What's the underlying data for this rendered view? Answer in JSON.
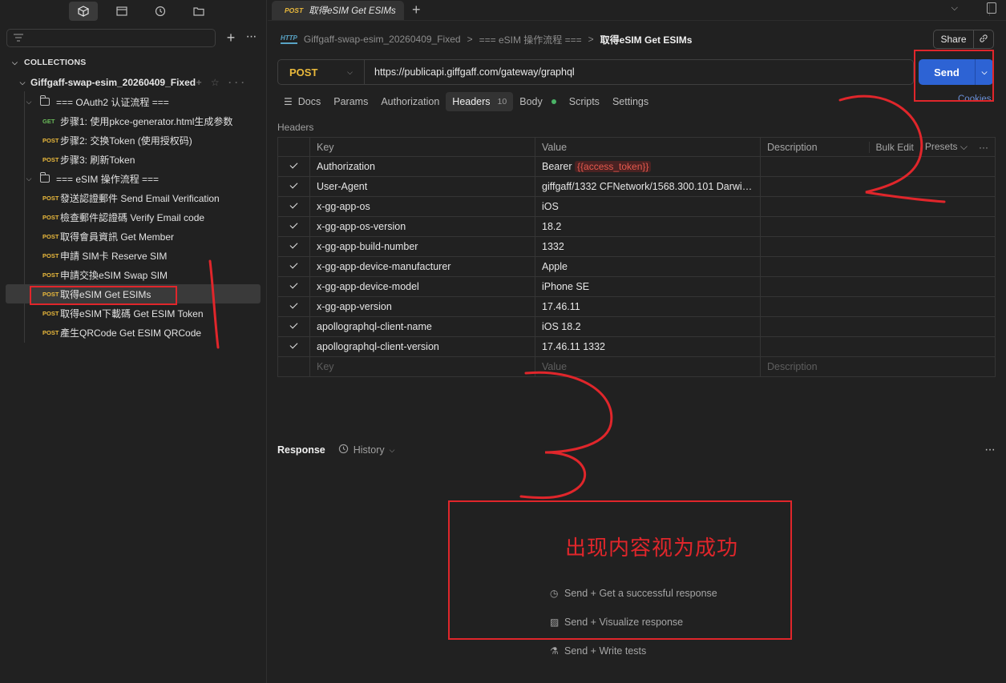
{
  "sidebar": {
    "collections_header": "COLLECTIONS",
    "collection_name": "Giffgaff-swap-esim_20260409_Fixed",
    "folders": [
      {
        "name": "=== OAuth2 认证流程 ===",
        "requests": [
          {
            "method": "GET",
            "name": "步骤1: 使用pkce-generator.html生成参数"
          },
          {
            "method": "POST",
            "name": "步骤2: 交换Token (使用授权码)"
          },
          {
            "method": "POST",
            "name": "步骤3: 刷新Token"
          }
        ]
      },
      {
        "name": "=== eSIM 操作流程 ===",
        "requests": [
          {
            "method": "POST",
            "name": "發送認證郵件 Send Email Verification"
          },
          {
            "method": "POST",
            "name": "檢查郵件認證碼 Verify Email code"
          },
          {
            "method": "POST",
            "name": "取得會員資訊 Get Member"
          },
          {
            "method": "POST",
            "name": "申請 SIM卡 Reserve SIM"
          },
          {
            "method": "POST",
            "name": "申請交換eSIM Swap SIM"
          },
          {
            "method": "POST",
            "name": "取得eSIM Get ESIMs"
          },
          {
            "method": "POST",
            "name": "取得eSIM下載碼 Get ESIM Token"
          },
          {
            "method": "POST",
            "name": "產生QRCode Get ESIM QRCode"
          }
        ]
      }
    ]
  },
  "tab": {
    "method": "POST",
    "title": "取得eSIM Get ESIMs"
  },
  "breadcrumb": {
    "collection": "Giffgaff-swap-esim_20260409_Fixed",
    "folder": "=== eSIM 操作流程 ===",
    "current": "取得eSIM Get ESIMs",
    "sep": ">",
    "icon_text": "HTTP"
  },
  "share_label": "Share",
  "request": {
    "method": "POST",
    "url": "https://publicapi.giffgaff.com/gateway/graphql",
    "send_label": "Send",
    "cookies_label": "Cookies"
  },
  "req_tabs": {
    "docs": "Docs",
    "params": "Params",
    "authorization": "Authorization",
    "headers": "Headers",
    "headers_count": "10",
    "body": "Body",
    "scripts": "Scripts",
    "settings": "Settings"
  },
  "headers_section": {
    "title": "Headers",
    "columns": {
      "key": "Key",
      "value": "Value",
      "description": "Description"
    },
    "bulk_edit": "Bulk Edit",
    "presets": "Presets",
    "rows": [
      {
        "key": "Authorization",
        "value_prefix": "Bearer ",
        "value_var": "{{access_token}}"
      },
      {
        "key": "User-Agent",
        "value": "giffgaff/1332 CFNetwork/1568.300.101 Darwin..."
      },
      {
        "key": "x-gg-app-os",
        "value": "iOS"
      },
      {
        "key": "x-gg-app-os-version",
        "value": "18.2"
      },
      {
        "key": "x-gg-app-build-number",
        "value": "1332"
      },
      {
        "key": "x-gg-app-device-manufacturer",
        "value": "Apple"
      },
      {
        "key": "x-gg-app-device-model",
        "value": "iPhone SE"
      },
      {
        "key": "x-gg-app-version",
        "value": "17.46.11"
      },
      {
        "key": "apollographql-client-name",
        "value": "iOS 18.2"
      },
      {
        "key": "apollographql-client-version",
        "value": "17.46.11 1332"
      }
    ],
    "placeholder": {
      "key": "Key",
      "value": "Value",
      "description": "Description"
    }
  },
  "response": {
    "title": "Response",
    "history": "History",
    "hints": [
      "Send + Get a successful response",
      "Send + Visualize response",
      "Send + Write tests"
    ]
  },
  "annotation": {
    "text": "出现内容视为成功",
    "color": "#e0262b"
  },
  "colors": {
    "accent": "#2d63d4",
    "post": "#eab93c",
    "get": "#6bbd5b",
    "background": "#212121"
  },
  "icons": [
    "collections-icon",
    "environments-icon",
    "history-icon",
    "folder-icon",
    "filter-icon",
    "plus-icon",
    "more-icon",
    "link-icon",
    "check-icon",
    "chevron-down-icon"
  ]
}
